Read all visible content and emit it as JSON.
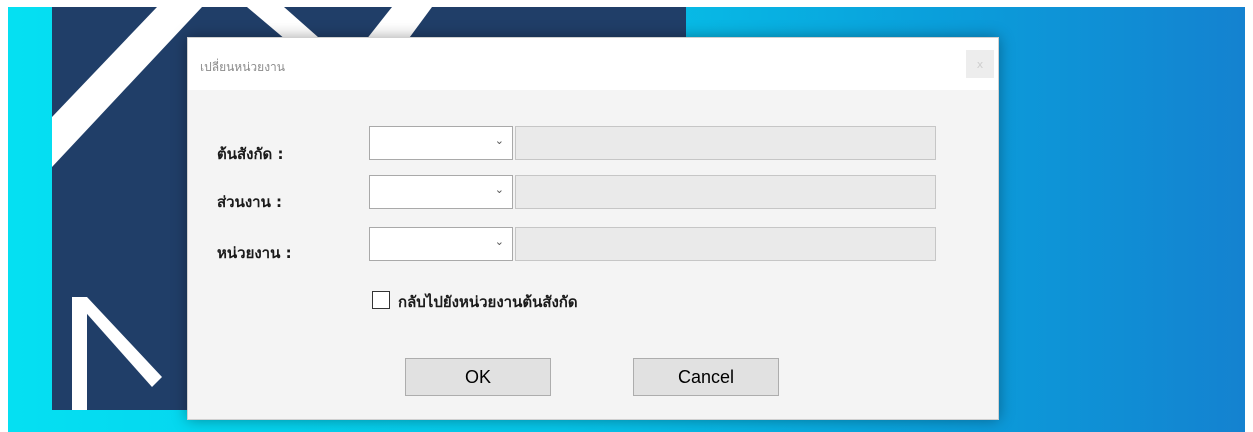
{
  "dialog": {
    "title": "เปลี่ยนหน่วยงาน",
    "close_label": "x"
  },
  "fields": [
    {
      "label": "ต้นสังกัด :",
      "value": ""
    },
    {
      "label": "ส่วนงาน :",
      "value": ""
    },
    {
      "label": "หน่วยงาน :",
      "value": ""
    }
  ],
  "return_checkbox": {
    "label": "กลับไปยังหน่วยงานต้นสังกัด",
    "checked": false
  },
  "buttons": {
    "ok": "OK",
    "cancel": "Cancel"
  },
  "colors": {
    "splash_background": "#203e68",
    "desktop_gradient_start": "#05e0f2",
    "desktop_gradient_end": "#1482d0",
    "dialog_background": "#f4f4f4"
  },
  "icons": {
    "dropdown": "chevron-down-icon",
    "close": "close-icon"
  }
}
